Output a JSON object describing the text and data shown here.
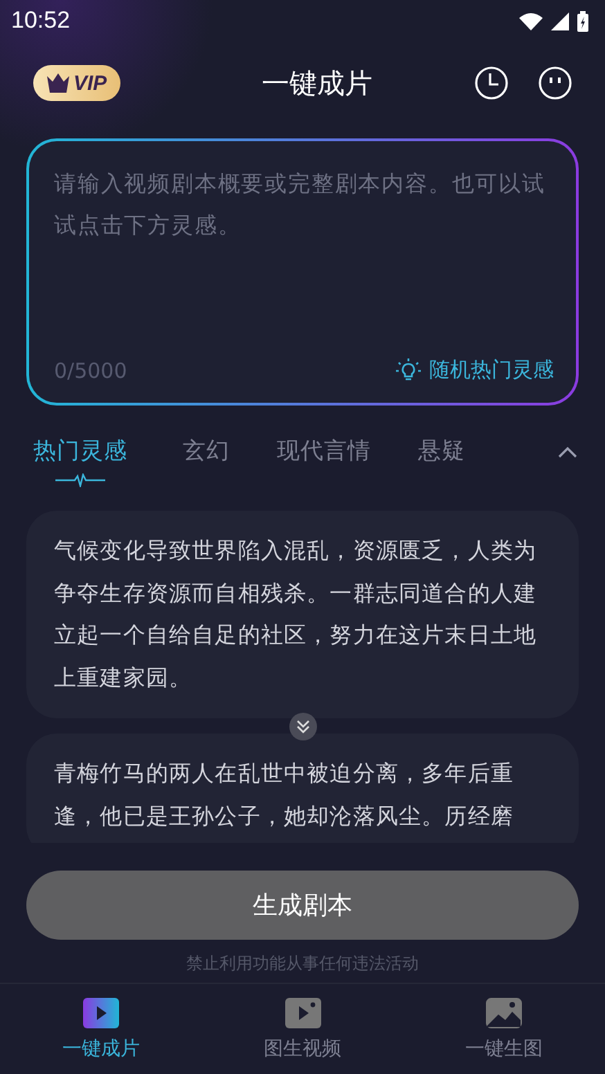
{
  "status_bar": {
    "time": "10:52"
  },
  "header": {
    "vip_badge": "VIP",
    "title": "一键成片"
  },
  "editor": {
    "placeholder": "请输入视频剧本概要或完整剧本内容。也可以试试点击下方灵感。",
    "counter": "0/5000",
    "inspire_button": "随机热门灵感"
  },
  "tabs": [
    {
      "label": "热门灵感",
      "selected": true
    },
    {
      "label": "玄幻",
      "selected": false
    },
    {
      "label": "现代言情",
      "selected": false
    },
    {
      "label": "悬疑",
      "selected": false
    }
  ],
  "ideas": [
    "气候变化导致世界陷入混乱，资源匮乏，人类为争夺生存资源而自相残杀。一群志同道合的人建立起一个自给自足的社区，努力在这片末日土地上重建家园。",
    "青梅竹马的两人在乱世中被迫分离，多年后重逢，他已是王孙公子，她却沦落风尘。历经磨"
  ],
  "generate_button": {
    "label": "生成剧本",
    "disabled": true
  },
  "disclaimer": "禁止利用功能从事任何违法活动",
  "bottom_nav": [
    {
      "label": "一键成片",
      "kind": "video",
      "selected": true
    },
    {
      "label": "图生视频",
      "kind": "image-video",
      "selected": false
    },
    {
      "label": "一键生图",
      "kind": "image",
      "selected": false
    }
  ]
}
